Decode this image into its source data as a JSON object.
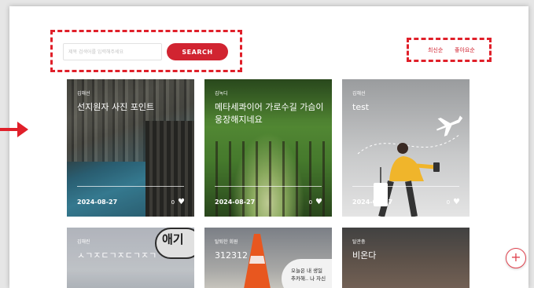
{
  "search": {
    "placeholder": "제목 검색어를 입력해주세요",
    "button_label": "SEARCH"
  },
  "sort": {
    "latest_label": "최신순",
    "likes_label": "좋아요순"
  },
  "cards": [
    {
      "author": "김해선",
      "title": "선지원자 사진 포인트",
      "date": "2024-08-27",
      "likes": "0"
    },
    {
      "author": "김녹디",
      "title": "메타세콰이어 가로수길 가슴이 웅장해지네요",
      "date": "2024-08-27",
      "likes": "0"
    },
    {
      "author": "김해선",
      "title": "test",
      "date": "2024-08-27",
      "likes": "0"
    },
    {
      "author": "김해린",
      "title": "ㅅㄱㅈㄷㄱㅈㄷㄱㅈㄱ",
      "comic_text": "애기"
    },
    {
      "author": "탈퇴한 회원",
      "title": "312312",
      "bubble_text_1": "오늘은 내 생일",
      "bubble_text_2": "추카해.. 나 자신"
    },
    {
      "author": "탈관충",
      "title": "비온다"
    }
  ],
  "colors": {
    "accent": "#d12431",
    "annotation": "#e0202a"
  },
  "icons": {
    "like": "heart-icon",
    "add": "plus-icon",
    "annotation": "arrow-right-icon"
  }
}
